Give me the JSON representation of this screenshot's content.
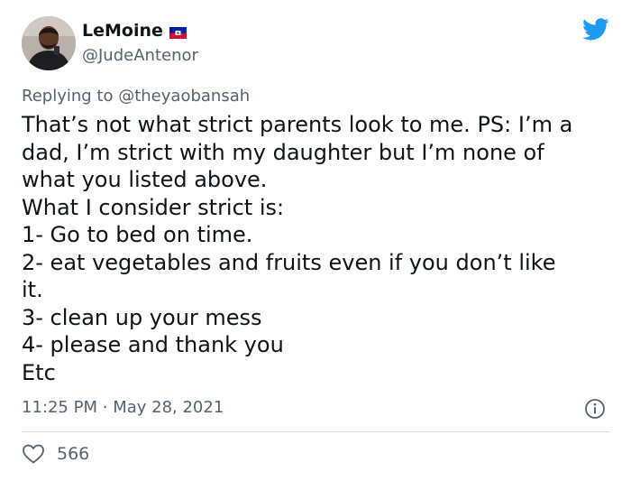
{
  "tweet": {
    "author": {
      "display_name": "LeMoine",
      "handle": "@JudeAntenor",
      "flag_icon": "haiti-flag-icon"
    },
    "platform_icon": "twitter-bird-icon",
    "reply": {
      "prefix": "Replying to",
      "to": "@theyaobansah"
    },
    "lines": [
      "That’s not what strict parents look to me. PS: I’m a",
      "dad, I’m strict with my daughter but I’m none of",
      "what you listed above.",
      "What I consider strict is:",
      "1- Go to bed on time.",
      "2- eat vegetables and fruits even if you don’t like",
      "it.",
      "3- clean up your mess",
      "4- please and thank you",
      "Etc"
    ],
    "time": "11:25 PM",
    "separator": "·",
    "date": "May 28, 2021",
    "likes": "566",
    "colors": {
      "bird": "#1d9bf0",
      "secondary_text": "#536471",
      "divider": "#cfd9de",
      "flag_blue": "#00209f",
      "flag_red": "#d21034"
    }
  }
}
